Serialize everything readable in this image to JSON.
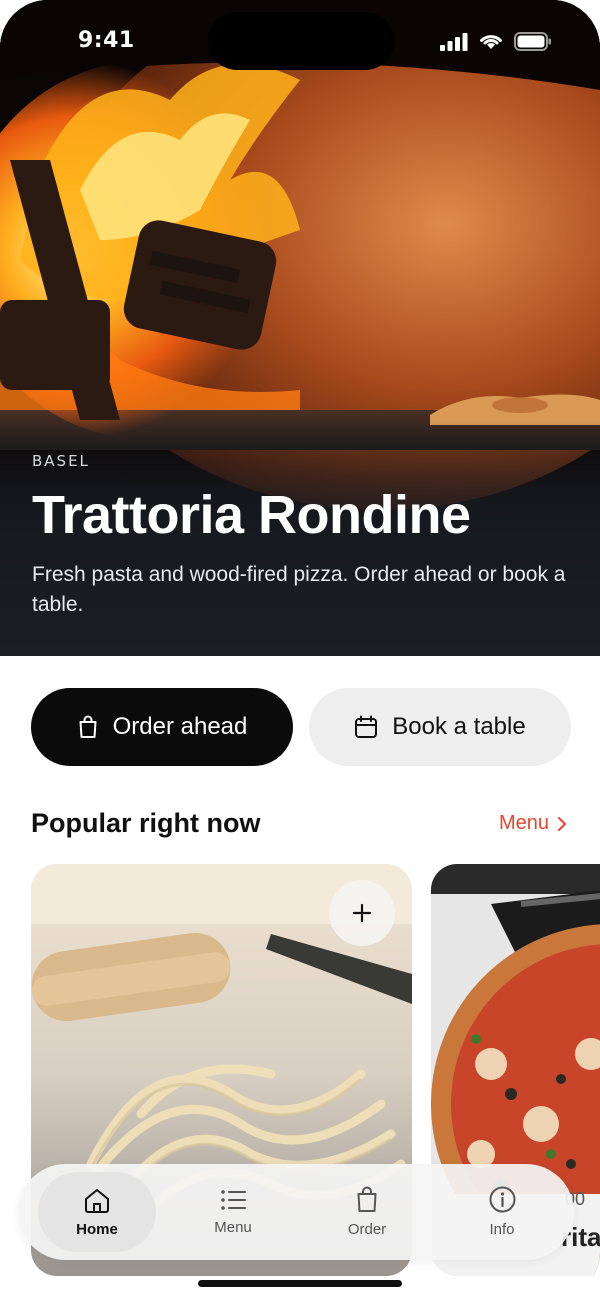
{
  "status_bar": {
    "time": "9:41"
  },
  "hero": {
    "city": "BASEL",
    "title": "Trattoria Rondine",
    "subtitle": "Fresh pasta and wood-fired pizza. Order ahead or book a table."
  },
  "actions": {
    "order_label": "Order ahead",
    "book_label": "Book a table"
  },
  "popular": {
    "title": "Popular right now",
    "menu_link": "Menu",
    "cards": [
      {
        "image": "fresh-pasta-photo",
        "add_icon": "plus-icon"
      },
      {
        "image": "pizza-photo",
        "price_fragment": "00",
        "name_fragment": "rita"
      }
    ]
  },
  "tabbar": {
    "items": [
      {
        "label": "Home",
        "icon": "home-icon",
        "active": true
      },
      {
        "label": "Menu",
        "icon": "list-icon",
        "active": false
      },
      {
        "label": "Order",
        "icon": "bag-icon",
        "active": false
      },
      {
        "label": "Info",
        "icon": "info-icon",
        "active": false
      }
    ]
  },
  "colors": {
    "accent": "#e8452c",
    "primary_button": "#0b0b0b",
    "secondary_button": "#eeeeee"
  }
}
